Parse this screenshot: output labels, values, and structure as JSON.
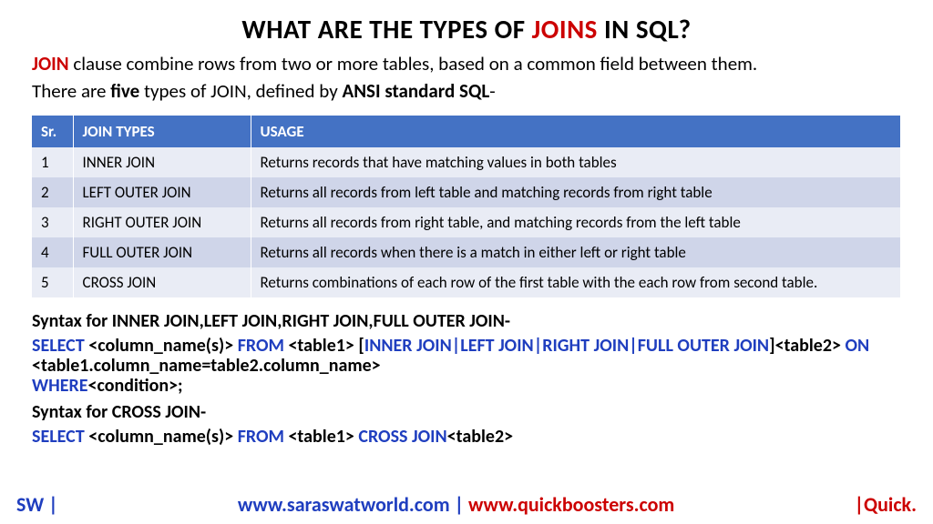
{
  "title_pre": "WHAT ARE THE TYPES OF ",
  "title_hl": "JOINS",
  "title_post": " IN SQL?",
  "intro_hl": "JOIN",
  "intro_rest": " clause combine rows from two or more tables, based on a common field between them.",
  "intro2_pre": "There are ",
  "intro2_b1": "five",
  "intro2_mid": " types of JOIN, defined by ",
  "intro2_b2": "ANSI standard SQL",
  "intro2_post": "-",
  "headers": {
    "sr": "Sr.",
    "type": "JOIN TYPES",
    "usage": "USAGE"
  },
  "rows": [
    {
      "sr": "1",
      "type": "INNER JOIN",
      "usage": "Returns records that have matching values in both tables"
    },
    {
      "sr": "2",
      "type": "LEFT OUTER JOIN",
      "usage": "Returns all records from left table and matching records from right table"
    },
    {
      "sr": "3",
      "type": "RIGHT OUTER JOIN",
      "usage": "Returns all records from right table, and matching records from the left table"
    },
    {
      "sr": "4",
      "type": "FULL OUTER JOIN",
      "usage": "Returns all records when there is a match in either left or right table"
    },
    {
      "sr": "5",
      "type": "CROSS JOIN",
      "usage": "Returns combinations of each row of the first table with the each row from second table."
    }
  ],
  "syntax1_hdr": "Syntax for INNER JOIN,LEFT JOIN,RIGHT JOIN,FULL OUTER JOIN-",
  "s1": {
    "k1": "SELECT",
    "t1": " <column_name(s)> ",
    "k2": "FROM",
    "t2": " <table1> [",
    "k3": "INNER JOIN|LEFT JOIN|RIGHT JOIN|FULL OUTER JOIN",
    "t3": "]<table2> ",
    "k4": "ON",
    "t4": " <table1.column_name=table2.column_name> ",
    "k5": "WHERE",
    "t5": "<condition>;"
  },
  "syntax2_hdr": "Syntax for CROSS JOIN-",
  "s2": {
    "k1": "SELECT",
    "t1": " <column_name(s)> ",
    "k2": "FROM",
    "t2": " <table1> ",
    "k3": "CROSS JOIN",
    "t3": "<table2>"
  },
  "footer": {
    "left": "SW |",
    "center_blue": "www.saraswatworld.com | ",
    "center_red": "www.quickboosters.com",
    "right": "|Quick."
  }
}
